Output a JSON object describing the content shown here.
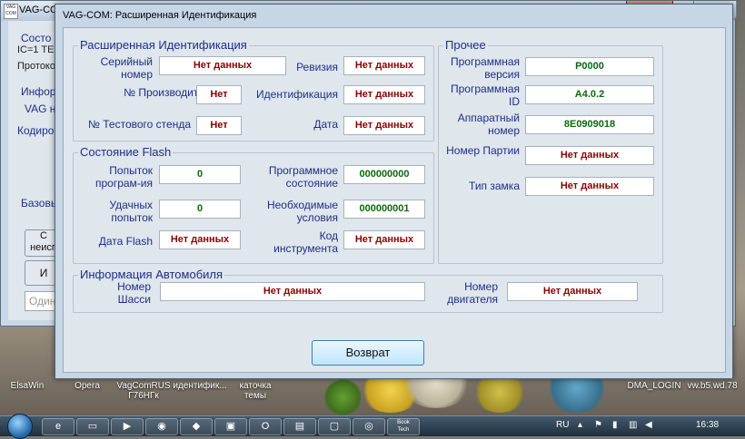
{
  "desktop": {
    "icons": [
      {
        "label": "ElsaWin"
      },
      {
        "label": "Opera"
      },
      {
        "label": "VagComRUS\nГ76НГк"
      },
      {
        "label": "идентифик..."
      },
      {
        "label": "каточка\nтемы"
      },
      {
        "label": "DMA_LOGIN"
      },
      {
        "label": "vw.b5.wd.78"
      }
    ]
  },
  "background_window": {
    "title": "VAG-COM: З...",
    "close_symbol": "✕",
    "extra_symbol": "✕",
    "labels": {
      "state": "Состо",
      "ic": "IC=1  TE-",
      "protocol": "Протоко",
      "info": "Инфор",
      "vag": "VAG н",
      "coding": "Кодиро",
      "basic": "Базовы"
    },
    "buttons": {
      "btn1": "С\nнеисп",
      "btn2": "И"
    },
    "input_placeholder": "Одино"
  },
  "dialog": {
    "title": "VAG-COM: Расширенная Идентификация",
    "groups": {
      "extended_id": {
        "header": "Расширенная Идентификация",
        "serial_label": "Серийный\nномер",
        "serial_value": "Нет данных",
        "revision_label": "Ревизия",
        "revision_value": "Нет данных",
        "manufacturer_label": "№ Производителя",
        "manufacturer_value": "Нет",
        "identification_label": "Идентификация",
        "identification_value": "Нет данных",
        "test_stand_label": "№ Тестового стенда",
        "test_stand_value": "Нет",
        "date_label": "Дата",
        "date_value": "Нет данных"
      },
      "flash": {
        "header": "Состояние Flash",
        "attempts_label": "Попыток\nпрограм-ия",
        "attempts_value": "0",
        "prog_state_label": "Программное\nсостояние",
        "prog_state_value": "000000000",
        "success_label": "Удачных\nпопыток",
        "success_value": "0",
        "conditions_label": "Необходимые\nусловия",
        "conditions_value": "000000001",
        "date_flash_label": "Дата Flash",
        "date_flash_value": "Нет данных",
        "tool_code_label": "Код\nинструмента",
        "tool_code_value": "Нет данных"
      },
      "other": {
        "header": "Прочее",
        "sw_version_label": "Программная\nверсия",
        "sw_version_value": "P0000",
        "sw_id_label": "Программная\nID",
        "sw_id_value": "A4.0.2",
        "hw_number_label": "Аппаратный\nномер",
        "hw_number_value": "8E0909018",
        "batch_label": "Номер Партии",
        "batch_value": "Нет данных",
        "lock_label": "Тип замка",
        "lock_value": "Нет данных"
      },
      "vehicle": {
        "header": "Информация Автомобиля",
        "chassis_label": "Номер\nШасси",
        "chassis_value": "Нет данных",
        "engine_label": "Номер\nдвигателя",
        "engine_value": "Нет данных"
      }
    },
    "back_button": "Возврат"
  },
  "taskbar": {
    "lang": "RU",
    "time": "16:38",
    "book_label": "Book\nTech",
    "buttons": [
      "ie",
      "folder",
      "firefox",
      "app",
      "media",
      "opera",
      "img",
      "win",
      "chrome"
    ]
  },
  "colors": {
    "value_red": "#8a0000",
    "value_green": "#0a6a0a",
    "label_blue": "#1d2f86"
  }
}
